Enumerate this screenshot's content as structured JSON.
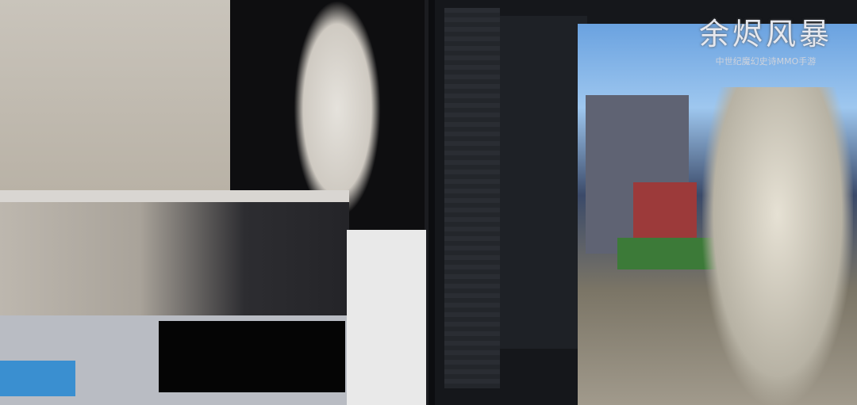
{
  "logo": {
    "title": "余烬风暴",
    "subtitle": "中世纪魔幻史诗MMO手游"
  }
}
